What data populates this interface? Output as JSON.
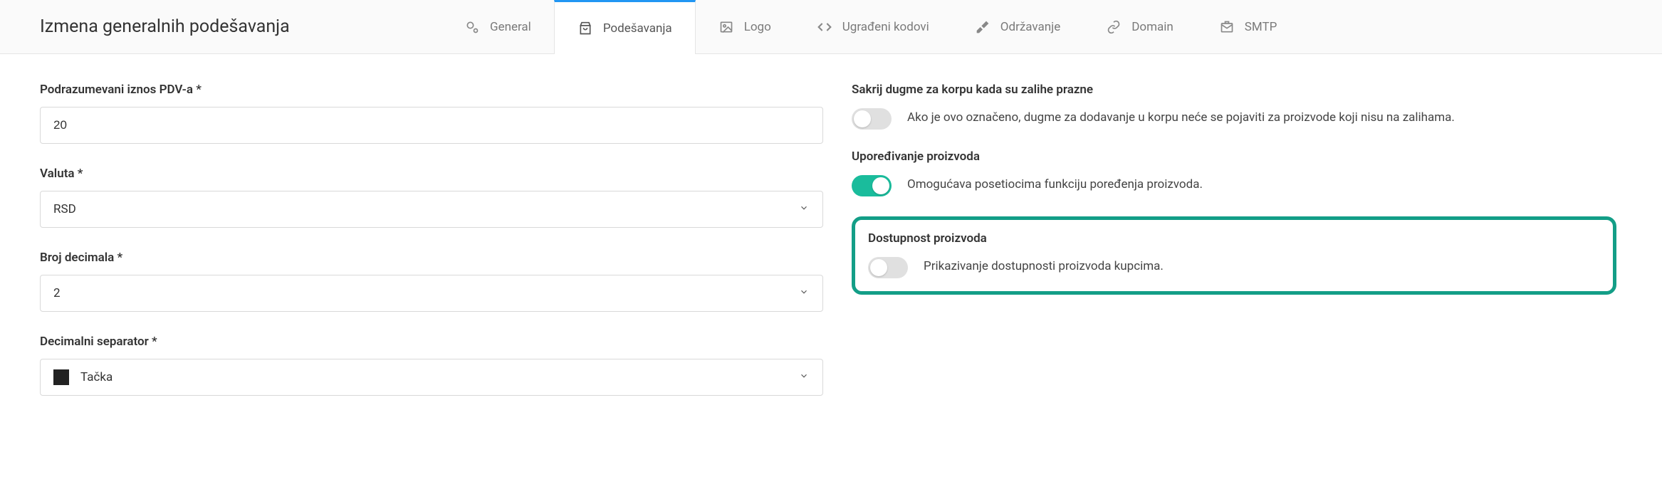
{
  "page_title": "Izmena generalnih podešavanja",
  "tabs": {
    "general": {
      "label": "General"
    },
    "settings": {
      "label": "Podešavanja"
    },
    "logo": {
      "label": "Logo"
    },
    "embedded": {
      "label": "Ugrađeni kodovi"
    },
    "maintenance": {
      "label": "Održavanje"
    },
    "domain": {
      "label": "Domain"
    },
    "smtp": {
      "label": "SMTP"
    }
  },
  "form": {
    "vat": {
      "label": "Podrazumevani iznos PDV-a *",
      "value": "20"
    },
    "currency": {
      "label": "Valuta *",
      "value": "RSD"
    },
    "decimals": {
      "label": "Broj decimala *",
      "value": "2"
    },
    "decimal_separator": {
      "label": "Decimalni separator *",
      "value": "Tačka"
    }
  },
  "toggles": {
    "hide_cart": {
      "title": "Sakrij dugme za korpu kada su zalihe prazne",
      "desc": "Ako je ovo označeno, dugme za dodavanje u korpu neće se pojaviti za proizvode koji nisu na zalihama."
    },
    "compare": {
      "title": "Upoređivanje proizvoda",
      "desc": "Omogućava posetiocima funkciju poređenja proizvoda."
    },
    "availability": {
      "title": "Dostupnost proizvoda",
      "desc": "Prikazivanje dostupnosti proizvoda kupcima."
    }
  }
}
